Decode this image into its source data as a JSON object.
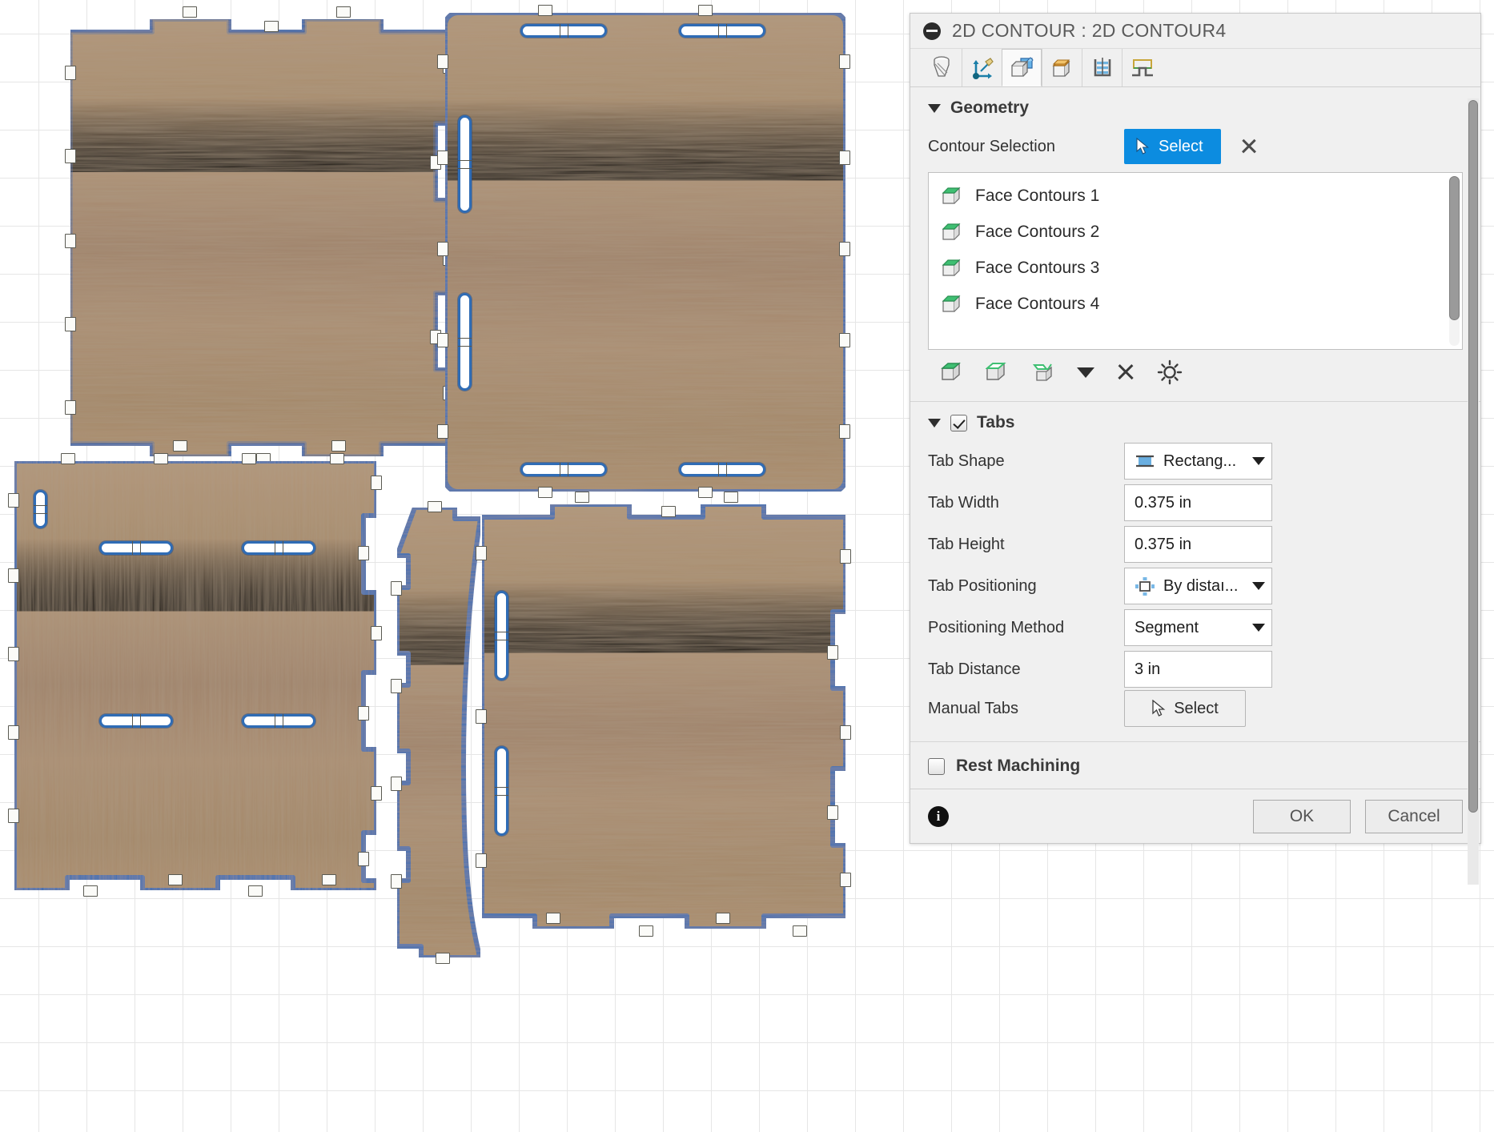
{
  "panel": {
    "title": "2D CONTOUR : 2D CONTOUR4",
    "collapse_icon": "minus-circle-icon",
    "tabs": [
      {
        "name": "tool-tab",
        "icon": "end-mill-tool-icon",
        "active": false
      },
      {
        "name": "setup-tab",
        "icon": "coordinate-axes-icon",
        "active": false
      },
      {
        "name": "geometry-tab",
        "icon": "geometry-solid-icon",
        "active": true
      },
      {
        "name": "heights-tab",
        "icon": "heights-box-icon",
        "active": false
      },
      {
        "name": "passes-tab",
        "icon": "passes-layers-icon",
        "active": false
      },
      {
        "name": "linking-tab",
        "icon": "linking-path-icon",
        "active": false
      }
    ],
    "geometry": {
      "heading": "Geometry",
      "contour_selection_label": "Contour Selection",
      "select_button": "Select",
      "clear_icon": "close-x-icon",
      "items": [
        "Face Contours 1",
        "Face Contours 2",
        "Face Contours 3",
        "Face Contours 4"
      ],
      "item_icon": "green-face-box-icon",
      "tools": [
        "select-face-icon",
        "select-face-outline-icon",
        "select-multiple-faces-icon",
        "dropdown-caret-icon",
        "delete-x-icon",
        "settings-gear-icon"
      ]
    },
    "tabs_section": {
      "heading": "Tabs",
      "enabled": true,
      "fields": [
        {
          "label": "Tab Shape",
          "value": "Rectang...",
          "type": "combo",
          "icon": "rectangle-tab-icon"
        },
        {
          "label": "Tab Width",
          "value": "0.375 in",
          "type": "text"
        },
        {
          "label": "Tab Height",
          "value": "0.375 in",
          "type": "text"
        },
        {
          "label": "Tab Positioning",
          "value": "By distaı...",
          "type": "combo",
          "icon": "distance-positioning-icon"
        },
        {
          "label": "Positioning Method",
          "value": "Segment",
          "type": "select"
        },
        {
          "label": "Tab Distance",
          "value": "3 in",
          "type": "text"
        },
        {
          "label": "Manual Tabs",
          "value": "Select",
          "type": "button",
          "icon": "cursor-arrow-icon"
        }
      ]
    },
    "rest_machining": {
      "label": "Rest Machining",
      "checked": false
    },
    "footer": {
      "info_icon": "info-icon",
      "info_glyph": "i",
      "ok": "OK",
      "cancel": "Cancel"
    }
  },
  "canvas": {
    "accent_contour_color": "#2f6cb5",
    "wood_color": "#a88a68",
    "grid_minor_color": "#e6e6e6",
    "grid_major_color": "#d2d2d2",
    "pieces": [
      {
        "name": "panel-top-left",
        "slots": 0
      },
      {
        "name": "panel-top-right",
        "slots": 6
      },
      {
        "name": "panel-bottom-left",
        "slots": 5
      },
      {
        "name": "panel-curved-spine",
        "slots": 0
      },
      {
        "name": "panel-bottom-right",
        "slots": 2
      }
    ]
  }
}
